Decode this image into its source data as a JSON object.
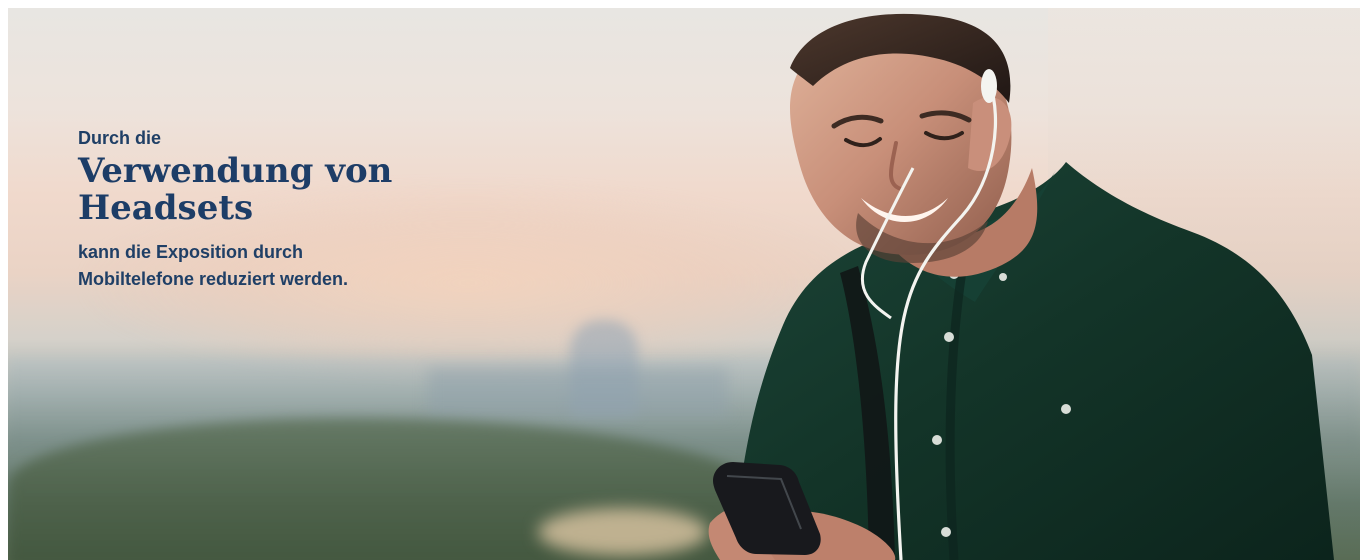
{
  "hero": {
    "kicker": "Durch die",
    "headline": "Verwendung von Headsets",
    "subtext": "kann die Exposition durch Mobiltelefone reduziert werden."
  },
  "colors": {
    "text": "#1f3f66",
    "shirt": "#15382e",
    "sky": "#eed9cc",
    "phone": "#18191d"
  },
  "image": {
    "subject": "smiling man with earphones using smartphone"
  }
}
